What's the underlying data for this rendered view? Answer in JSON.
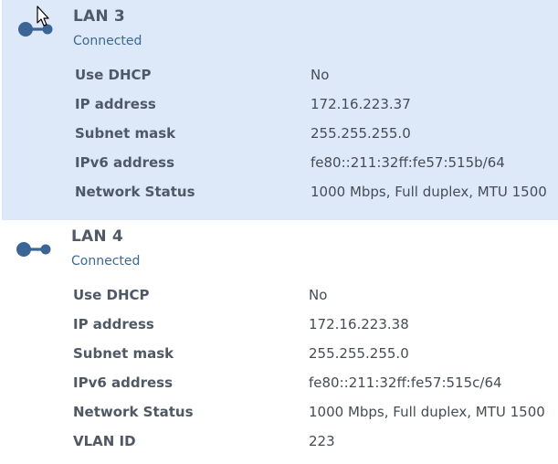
{
  "lan3": {
    "title": "LAN 3",
    "status": "Connected",
    "rows": [
      {
        "key": "Use DHCP",
        "value": "No"
      },
      {
        "key": "IP address",
        "value": "172.16.223.37"
      },
      {
        "key": "Subnet mask",
        "value": "255.255.255.0"
      },
      {
        "key": "IPv6 address",
        "value": "fe80::211:32ff:fe57:515b/64"
      },
      {
        "key": "Network Status",
        "value": "1000 Mbps, Full duplex, MTU 1500"
      }
    ]
  },
  "lan4": {
    "title": "LAN 4",
    "status": "Connected",
    "rows": [
      {
        "key": "Use DHCP",
        "value": "No"
      },
      {
        "key": "IP address",
        "value": "172.16.223.38"
      },
      {
        "key": "Subnet mask",
        "value": "255.255.255.0"
      },
      {
        "key": "IPv6 address",
        "value": "fe80::211:32ff:fe57:515c/64"
      },
      {
        "key": "Network Status",
        "value": "1000 Mbps, Full duplex, MTU 1500"
      },
      {
        "key": "VLAN ID",
        "value": "223"
      }
    ]
  },
  "icons": {
    "network": "network-connection-icon",
    "cursor": "mouse-pointer-icon"
  },
  "colors": {
    "selected_background": "#dde8f9",
    "icon": "#3b6597"
  }
}
